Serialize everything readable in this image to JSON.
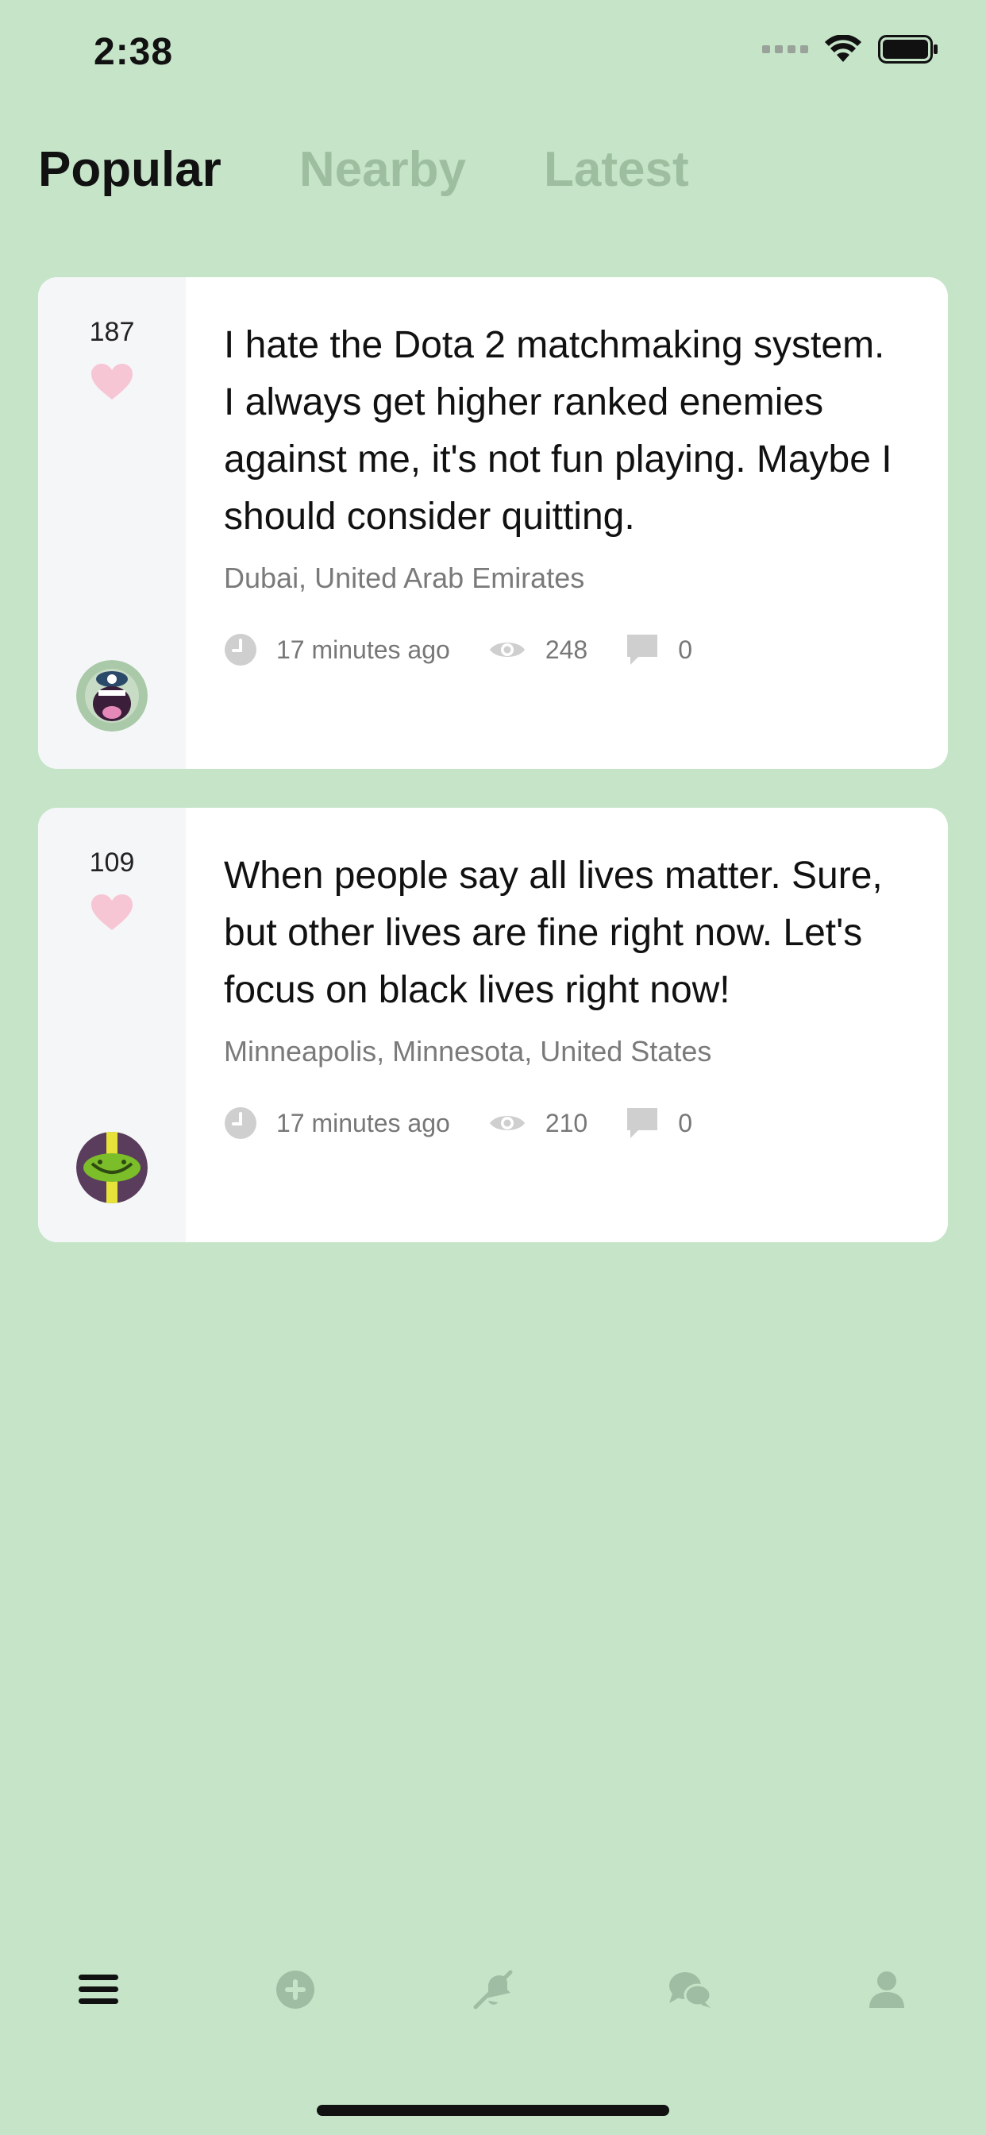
{
  "status_bar": {
    "time": "2:38"
  },
  "tabs": [
    {
      "label": "Popular",
      "active": true
    },
    {
      "label": "Nearby",
      "active": false
    },
    {
      "label": "Latest",
      "active": false
    }
  ],
  "posts": [
    {
      "likes": "187",
      "text": "I hate the Dota 2 matchmaking system. I always get higher ranked enemies against me, it's not fun playing. Maybe I should consider quitting.",
      "location": "Dubai, United Arab Emirates",
      "time": "17 minutes ago",
      "views": "248",
      "comments": "0",
      "avatar_icon": "screaming-monster-icon"
    },
    {
      "likes": "109",
      "text": "When people say all lives matter. Sure, but other lives are fine right now. Let's focus on black lives right now!",
      "location": "Minneapolis, Minnesota, United States",
      "time": "17 minutes ago",
      "views": "210",
      "comments": "0",
      "avatar_icon": "pickle-face-icon"
    }
  ],
  "bottom_nav": [
    {
      "icon": "menu-icon",
      "active": true
    },
    {
      "icon": "add-circle-icon",
      "active": false
    },
    {
      "icon": "notifications-off-icon",
      "active": false
    },
    {
      "icon": "chat-bubbles-icon",
      "active": false
    },
    {
      "icon": "profile-icon",
      "active": false
    }
  ],
  "colors": {
    "background": "#c5e4c8",
    "inactive_tab": "#9dbf9f",
    "heart": "#f7c6d4",
    "icon_gray": "#cfcfcf",
    "nav_inactive": "#9fbda2"
  }
}
